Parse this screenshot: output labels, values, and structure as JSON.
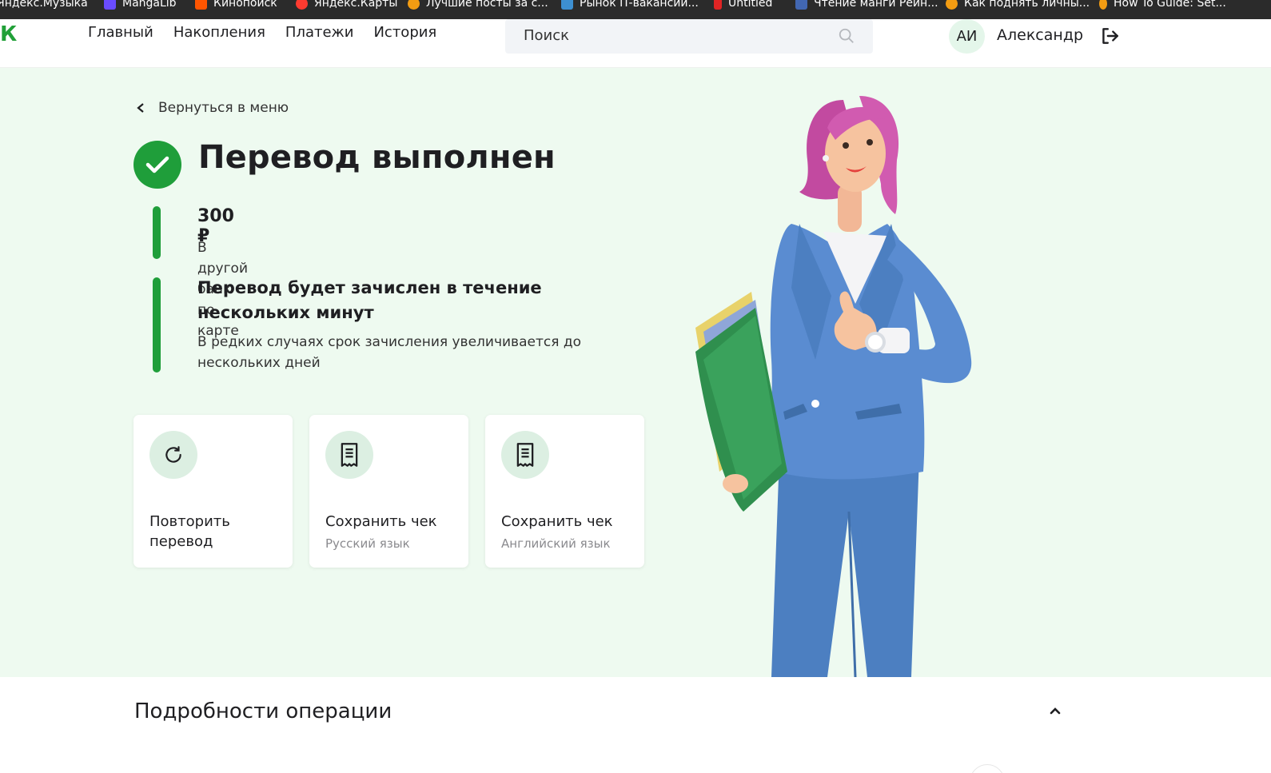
{
  "bookmarks": [
    {
      "label": "Яндекс.Музыка",
      "color": "#ffcc00"
    },
    {
      "label": "MangaLib",
      "color": "#6a4cff"
    },
    {
      "label": "Кинопоиск",
      "color": "#ff5500"
    },
    {
      "label": "Яндекс.Карты",
      "color": "#ff3b30"
    },
    {
      "label": "Лучшие посты за с...",
      "color": "#f39c12"
    },
    {
      "label": "Рынок IT-вакансий...",
      "color": "#3d8fd1"
    },
    {
      "label": "Untitled",
      "color": "#e02424"
    },
    {
      "label": "Чтение манги Рейн...",
      "color": "#4267b2"
    },
    {
      "label": "Как поднять личны...",
      "color": "#f39c12"
    },
    {
      "label": "How To Guide: Set...",
      "color": "#f39c12"
    }
  ],
  "header": {
    "logo": "К",
    "nav": [
      "Главный",
      "Накопления",
      "Платежи",
      "История"
    ],
    "search_placeholder": "Поиск",
    "avatar_initials": "АИ",
    "username": "Александр"
  },
  "hero": {
    "back_label": "Вернуться в меню",
    "title": "Перевод выполнен",
    "amount": "300 ₽",
    "amount_desc": "В другой банк по карте",
    "notice_title": "Перевод будет зачислен в течение нескольких минут",
    "notice_desc": "В редких случаях срок зачисления увеличивается до нескольких дней"
  },
  "actions": [
    {
      "label": "Повторить перевод",
      "sub": "",
      "icon": "repeat-icon"
    },
    {
      "label": "Сохранить чек",
      "sub": "Русский язык",
      "icon": "receipt-icon"
    },
    {
      "label": "Сохранить чек",
      "sub": "Английский язык",
      "icon": "receipt-icon"
    }
  ],
  "details": {
    "title": "Подробности операции"
  },
  "colors": {
    "accent": "#1f9e3a",
    "hero_bg": "#eefaf0",
    "icon_bg": "#dcefe2"
  }
}
